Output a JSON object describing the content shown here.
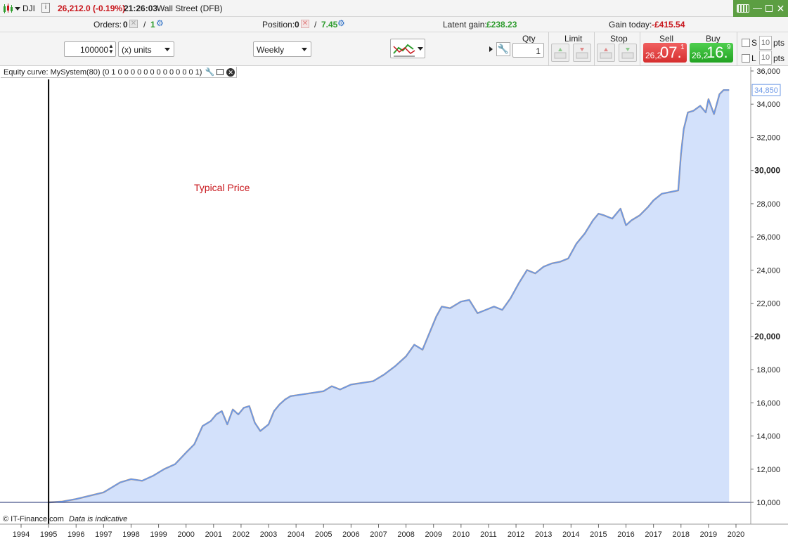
{
  "topbar": {
    "instrument": "DJI",
    "price_change": "26,212.0 (-0.19%)",
    "time": "21:26:03",
    "market_name": "Wall Street (DFB)"
  },
  "infobar": {
    "orders_label": "Orders:",
    "orders_count": "0",
    "orders_sep": "/",
    "orders_active": "1",
    "position_label": "Position:",
    "position_count": "0",
    "position_sep": "/",
    "position_value": "7.45",
    "latent_label": "Latent gain:",
    "latent_value": "£238.23",
    "gain_today_label": "Gain today:",
    "gain_today_value": "-£415.54"
  },
  "order_panel": {
    "quantity_value": "100000",
    "units_select": "(x) units",
    "timeframe_select": "Weekly",
    "qty_header": "Qty",
    "qty_value": "1",
    "limit_header": "Limit",
    "stop_header": "Stop",
    "sell_header": "Sell",
    "buy_header": "Buy",
    "sell_prefix": "26,2",
    "sell_big": "07.",
    "sell_sup": "1",
    "buy_prefix": "26,2",
    "buy_big": "16.",
    "buy_sup": "9",
    "s_label": "S",
    "l_label": "L",
    "s_pts_value": "10",
    "l_pts_value": "10",
    "pts_label": "pts"
  },
  "chart_header": {
    "title": "Equity curve: MySystem(80) (0 1 0 0 0 0 0 0 0 0 0 0 0 0 1)"
  },
  "chart_annotation": "Typical Price",
  "footer": {
    "copyright": "© IT-Finance.com",
    "note": "Data is indicative"
  },
  "colors": {
    "line": "#6c98e6",
    "fill": "#d3e1fb",
    "orange": "#f5a23a",
    "annotation": "#c8151b",
    "last_value": "#6c98e6"
  },
  "chart_data": {
    "type": "area",
    "title": "Equity curve: MySystem(80) (0 1 0 0 0 0 0 0 0 0 0 0 0 0 1)",
    "xlabel": "",
    "ylabel": "",
    "x_ticks": [
      "1994",
      "1995",
      "1996",
      "1997",
      "1998",
      "1999",
      "2000",
      "2001",
      "2002",
      "2003",
      "2004",
      "2005",
      "2006",
      "2007",
      "2008",
      "2009",
      "2010",
      "2011",
      "2012",
      "2013",
      "2014",
      "2015",
      "2016",
      "2017",
      "2018",
      "2019",
      "2020"
    ],
    "y_ticks": [
      10000,
      12000,
      14000,
      16000,
      18000,
      20000,
      22000,
      24000,
      26000,
      28000,
      30000,
      32000,
      34000,
      36000
    ],
    "y_tick_labels": [
      "10,000",
      "12,000",
      "14,000",
      "16,000",
      "18,000",
      "20,000",
      "22,000",
      "24,000",
      "26,000",
      "28,000",
      "30,000",
      "32,000",
      "34,000",
      "36,000"
    ],
    "xlim": [
      1993.6,
      2020.5
    ],
    "ylim": [
      9000,
      36300
    ],
    "baseline": 10000,
    "vertical_marker": 1995.0,
    "last_value": 34850,
    "last_value_label": "34,850",
    "series": [
      {
        "x": [
          1995.0,
          1995.5,
          1996.0,
          1996.5,
          1997.0,
          1997.3,
          1997.6,
          1998.0,
          1998.4,
          1998.8,
          1999.2,
          1999.6,
          2000.0,
          2000.3,
          2000.6,
          2000.9,
          2001.1,
          2001.3,
          2001.5,
          2001.7,
          2001.9,
          2002.1,
          2002.3,
          2002.5,
          2002.7,
          2003.0,
          2003.2,
          2003.4,
          2003.6,
          2003.8,
          2004.2,
          2004.6,
          2005.0,
          2005.3,
          2005.6,
          2006.0,
          2006.4,
          2006.8,
          2007.2,
          2007.6,
          2008.0,
          2008.3,
          2008.6,
          2008.9,
          2009.1,
          2009.3,
          2009.6,
          2010.0,
          2010.3,
          2010.6,
          2010.9,
          2011.2,
          2011.5,
          2011.8,
          2012.1,
          2012.4,
          2012.7,
          2013.0,
          2013.3,
          2013.6,
          2013.9,
          2014.2,
          2014.5,
          2014.8,
          2015.0,
          2015.2,
          2015.5,
          2015.8,
          2016.0,
          2016.2,
          2016.5,
          2016.8,
          2017.0,
          2017.3,
          2017.6,
          2017.9,
          2018.0,
          2018.1,
          2018.25,
          2018.45,
          2018.7,
          2018.9,
          2019.0,
          2019.2,
          2019.4,
          2019.55,
          2019.75
        ],
        "y": [
          10000,
          10050,
          10200,
          10400,
          10600,
          10900,
          11200,
          11400,
          11300,
          11600,
          12000,
          12300,
          13000,
          13500,
          14600,
          14900,
          15300,
          15500,
          14700,
          15600,
          15300,
          15700,
          15800,
          14800,
          14300,
          14700,
          15500,
          15900,
          16200,
          16400,
          16500,
          16600,
          16700,
          17000,
          16800,
          17100,
          17200,
          17300,
          17700,
          18200,
          18800,
          19500,
          19200,
          20400,
          21200,
          21800,
          21700,
          22100,
          22200,
          21400,
          21600,
          21800,
          21600,
          22300,
          23200,
          24000,
          23800,
          24200,
          24400,
          24500,
          24700,
          25600,
          26200,
          27000,
          27400,
          27300,
          27100,
          27700,
          26700,
          27000,
          27300,
          27800,
          28200,
          28600,
          28700,
          28800,
          31000,
          32500,
          33500,
          33600,
          33900,
          33500,
          34300,
          33400,
          34600,
          34850,
          34850
        ]
      }
    ]
  }
}
